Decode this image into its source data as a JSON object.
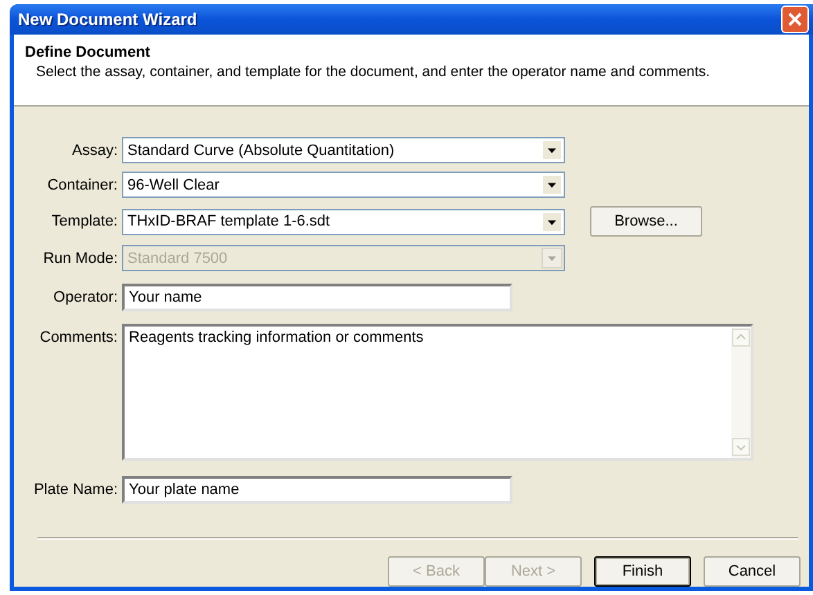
{
  "window": {
    "title": "New Document Wizard"
  },
  "header": {
    "title": "Define Document",
    "description": "Select the assay, container, and template for the document, and enter the operator name and comments."
  },
  "fields": [
    {
      "kind": "combo",
      "label": "Assay:",
      "value": "Standard Curve (Absolute Quantitation)",
      "disabled": false
    },
    {
      "kind": "combo",
      "label": "Container:",
      "value": "96-Well Clear",
      "disabled": false
    },
    {
      "kind": "combo",
      "label": "Template:",
      "value": "THxID-BRAF template 1-6.sdt",
      "disabled": false,
      "button": "Browse..."
    },
    {
      "kind": "combo",
      "label": "Run Mode:",
      "value": "Standard 7500",
      "disabled": true
    },
    {
      "kind": "text",
      "label": "Operator:",
      "value": "Your name"
    },
    {
      "kind": "textarea",
      "label": "Comments:",
      "value": "Reagents tracking information or comments"
    },
    {
      "kind": "text",
      "label": "Plate Name:",
      "value": "Your plate name"
    }
  ],
  "buttons": [
    {
      "label": "< Back",
      "disabled": true,
      "default": false
    },
    {
      "label": "Next >",
      "disabled": true,
      "default": false
    },
    {
      "label": "Finish",
      "disabled": false,
      "default": true
    },
    {
      "label": "Cancel",
      "disabled": false,
      "default": false
    }
  ]
}
